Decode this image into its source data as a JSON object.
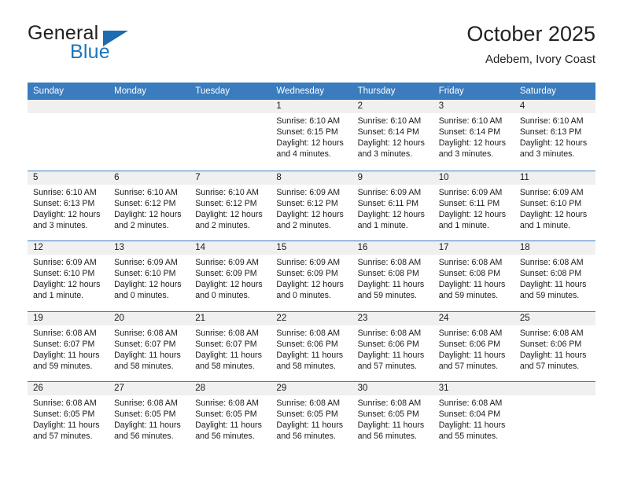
{
  "brand": {
    "name_top": "General",
    "name_bottom": "Blue",
    "accent_color": "#1b75bb",
    "triangle_icon": "triangle-icon"
  },
  "header": {
    "title": "October 2025",
    "subtitle": "Adebem, Ivory Coast"
  },
  "calendar": {
    "header_bg": "#3a7cbe",
    "day_band_bg": "#f0f0f0",
    "weekdays": [
      "Sunday",
      "Monday",
      "Tuesday",
      "Wednesday",
      "Thursday",
      "Friday",
      "Saturday"
    ],
    "weeks": [
      [
        {
          "day": "",
          "empty": true
        },
        {
          "day": "",
          "empty": true
        },
        {
          "day": "",
          "empty": true
        },
        {
          "day": "1",
          "sunrise": "Sunrise: 6:10 AM",
          "sunset": "Sunset: 6:15 PM",
          "daylight": "Daylight: 12 hours and 4 minutes."
        },
        {
          "day": "2",
          "sunrise": "Sunrise: 6:10 AM",
          "sunset": "Sunset: 6:14 PM",
          "daylight": "Daylight: 12 hours and 3 minutes."
        },
        {
          "day": "3",
          "sunrise": "Sunrise: 6:10 AM",
          "sunset": "Sunset: 6:14 PM",
          "daylight": "Daylight: 12 hours and 3 minutes."
        },
        {
          "day": "4",
          "sunrise": "Sunrise: 6:10 AM",
          "sunset": "Sunset: 6:13 PM",
          "daylight": "Daylight: 12 hours and 3 minutes."
        }
      ],
      [
        {
          "day": "5",
          "sunrise": "Sunrise: 6:10 AM",
          "sunset": "Sunset: 6:13 PM",
          "daylight": "Daylight: 12 hours and 3 minutes."
        },
        {
          "day": "6",
          "sunrise": "Sunrise: 6:10 AM",
          "sunset": "Sunset: 6:12 PM",
          "daylight": "Daylight: 12 hours and 2 minutes."
        },
        {
          "day": "7",
          "sunrise": "Sunrise: 6:10 AM",
          "sunset": "Sunset: 6:12 PM",
          "daylight": "Daylight: 12 hours and 2 minutes."
        },
        {
          "day": "8",
          "sunrise": "Sunrise: 6:09 AM",
          "sunset": "Sunset: 6:12 PM",
          "daylight": "Daylight: 12 hours and 2 minutes."
        },
        {
          "day": "9",
          "sunrise": "Sunrise: 6:09 AM",
          "sunset": "Sunset: 6:11 PM",
          "daylight": "Daylight: 12 hours and 1 minute."
        },
        {
          "day": "10",
          "sunrise": "Sunrise: 6:09 AM",
          "sunset": "Sunset: 6:11 PM",
          "daylight": "Daylight: 12 hours and 1 minute."
        },
        {
          "day": "11",
          "sunrise": "Sunrise: 6:09 AM",
          "sunset": "Sunset: 6:10 PM",
          "daylight": "Daylight: 12 hours and 1 minute."
        }
      ],
      [
        {
          "day": "12",
          "sunrise": "Sunrise: 6:09 AM",
          "sunset": "Sunset: 6:10 PM",
          "daylight": "Daylight: 12 hours and 1 minute."
        },
        {
          "day": "13",
          "sunrise": "Sunrise: 6:09 AM",
          "sunset": "Sunset: 6:10 PM",
          "daylight": "Daylight: 12 hours and 0 minutes."
        },
        {
          "day": "14",
          "sunrise": "Sunrise: 6:09 AM",
          "sunset": "Sunset: 6:09 PM",
          "daylight": "Daylight: 12 hours and 0 minutes."
        },
        {
          "day": "15",
          "sunrise": "Sunrise: 6:09 AM",
          "sunset": "Sunset: 6:09 PM",
          "daylight": "Daylight: 12 hours and 0 minutes."
        },
        {
          "day": "16",
          "sunrise": "Sunrise: 6:08 AM",
          "sunset": "Sunset: 6:08 PM",
          "daylight": "Daylight: 11 hours and 59 minutes."
        },
        {
          "day": "17",
          "sunrise": "Sunrise: 6:08 AM",
          "sunset": "Sunset: 6:08 PM",
          "daylight": "Daylight: 11 hours and 59 minutes."
        },
        {
          "day": "18",
          "sunrise": "Sunrise: 6:08 AM",
          "sunset": "Sunset: 6:08 PM",
          "daylight": "Daylight: 11 hours and 59 minutes."
        }
      ],
      [
        {
          "day": "19",
          "sunrise": "Sunrise: 6:08 AM",
          "sunset": "Sunset: 6:07 PM",
          "daylight": "Daylight: 11 hours and 59 minutes."
        },
        {
          "day": "20",
          "sunrise": "Sunrise: 6:08 AM",
          "sunset": "Sunset: 6:07 PM",
          "daylight": "Daylight: 11 hours and 58 minutes."
        },
        {
          "day": "21",
          "sunrise": "Sunrise: 6:08 AM",
          "sunset": "Sunset: 6:07 PM",
          "daylight": "Daylight: 11 hours and 58 minutes."
        },
        {
          "day": "22",
          "sunrise": "Sunrise: 6:08 AM",
          "sunset": "Sunset: 6:06 PM",
          "daylight": "Daylight: 11 hours and 58 minutes."
        },
        {
          "day": "23",
          "sunrise": "Sunrise: 6:08 AM",
          "sunset": "Sunset: 6:06 PM",
          "daylight": "Daylight: 11 hours and 57 minutes."
        },
        {
          "day": "24",
          "sunrise": "Sunrise: 6:08 AM",
          "sunset": "Sunset: 6:06 PM",
          "daylight": "Daylight: 11 hours and 57 minutes."
        },
        {
          "day": "25",
          "sunrise": "Sunrise: 6:08 AM",
          "sunset": "Sunset: 6:06 PM",
          "daylight": "Daylight: 11 hours and 57 minutes."
        }
      ],
      [
        {
          "day": "26",
          "sunrise": "Sunrise: 6:08 AM",
          "sunset": "Sunset: 6:05 PM",
          "daylight": "Daylight: 11 hours and 57 minutes."
        },
        {
          "day": "27",
          "sunrise": "Sunrise: 6:08 AM",
          "sunset": "Sunset: 6:05 PM",
          "daylight": "Daylight: 11 hours and 56 minutes."
        },
        {
          "day": "28",
          "sunrise": "Sunrise: 6:08 AM",
          "sunset": "Sunset: 6:05 PM",
          "daylight": "Daylight: 11 hours and 56 minutes."
        },
        {
          "day": "29",
          "sunrise": "Sunrise: 6:08 AM",
          "sunset": "Sunset: 6:05 PM",
          "daylight": "Daylight: 11 hours and 56 minutes."
        },
        {
          "day": "30",
          "sunrise": "Sunrise: 6:08 AM",
          "sunset": "Sunset: 6:05 PM",
          "daylight": "Daylight: 11 hours and 56 minutes."
        },
        {
          "day": "31",
          "sunrise": "Sunrise: 6:08 AM",
          "sunset": "Sunset: 6:04 PM",
          "daylight": "Daylight: 11 hours and 55 minutes."
        },
        {
          "day": "",
          "empty": true
        }
      ]
    ]
  }
}
